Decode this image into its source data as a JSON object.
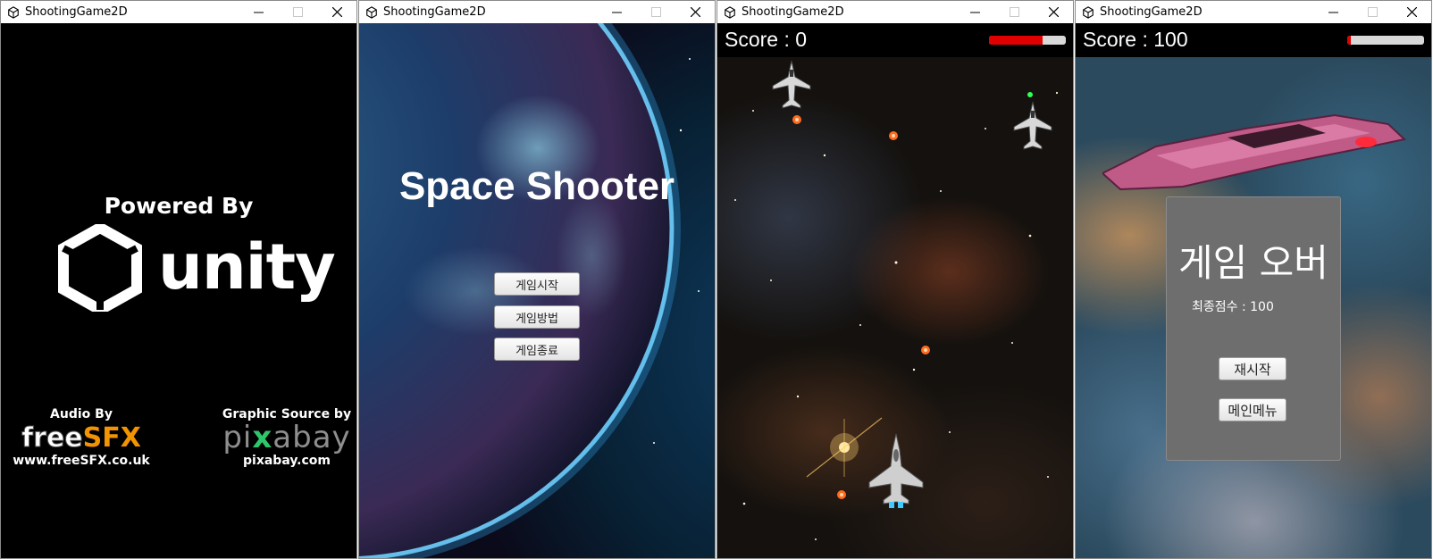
{
  "windows": [
    {
      "title": "ShootingGame2D"
    },
    {
      "title": "ShootingGame2D"
    },
    {
      "title": "ShootingGame2D"
    },
    {
      "title": "ShootingGame2D"
    }
  ],
  "splash": {
    "powered_by": "Powered By",
    "unity_word": "unity",
    "audio_label": "Audio By",
    "audio_logo_free": "free",
    "audio_logo_sfx": "SFX",
    "audio_url": "www.freeSFX.co.uk",
    "graphic_label": "Graphic Source by",
    "graphic_logo_a": "pi",
    "graphic_logo_x": "x",
    "graphic_logo_b": "abay",
    "graphic_url": "pixabay.com"
  },
  "menu": {
    "title": "Space Shooter",
    "buttons": [
      "게임시작",
      "게임방법",
      "게임종료"
    ]
  },
  "game": {
    "score_text": "Score : 0",
    "health_fraction": 0.7
  },
  "gameover": {
    "score_text": "Score : 100",
    "health_fraction": 0.05,
    "title": "게임 오버",
    "final_score": "최종점수 : 100",
    "restart": "재시작",
    "main_menu": "메인메뉴"
  },
  "colors": {
    "splash_bg": "#000000",
    "hp_red": "#e00000",
    "panel_gray": "#6e6e6e"
  }
}
